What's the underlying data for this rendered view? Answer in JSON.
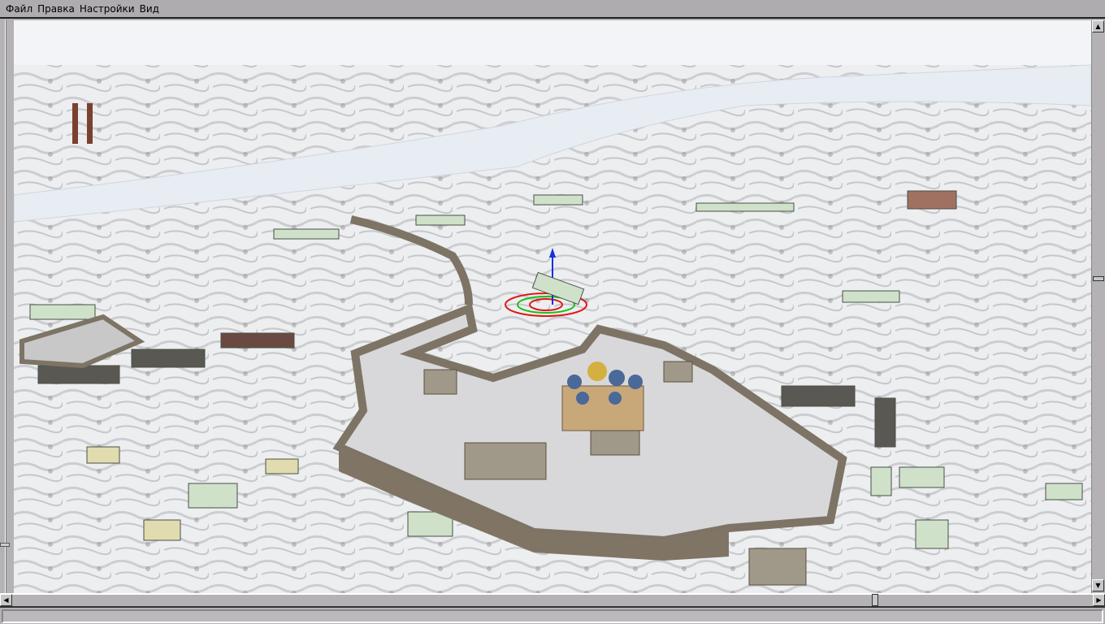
{
  "menu": {
    "items": [
      {
        "label": "Файл"
      },
      {
        "label": "Правка"
      },
      {
        "label": "Настройки"
      },
      {
        "label": "Вид"
      }
    ]
  },
  "scene": {
    "colors": {
      "snow": "#eceef2",
      "river": "#e6ecf3",
      "wall": "#7d7466",
      "courtyard": "#d6d6d6",
      "building_green": "#cfe1c8",
      "gizmo_red": "#e01818",
      "gizmo_green": "#18c018",
      "gizmo_blue": "#1830e0"
    }
  },
  "scroll": {
    "vertical_position": 0.45,
    "horizontal_position": 0.8
  },
  "status": {
    "text": ""
  }
}
